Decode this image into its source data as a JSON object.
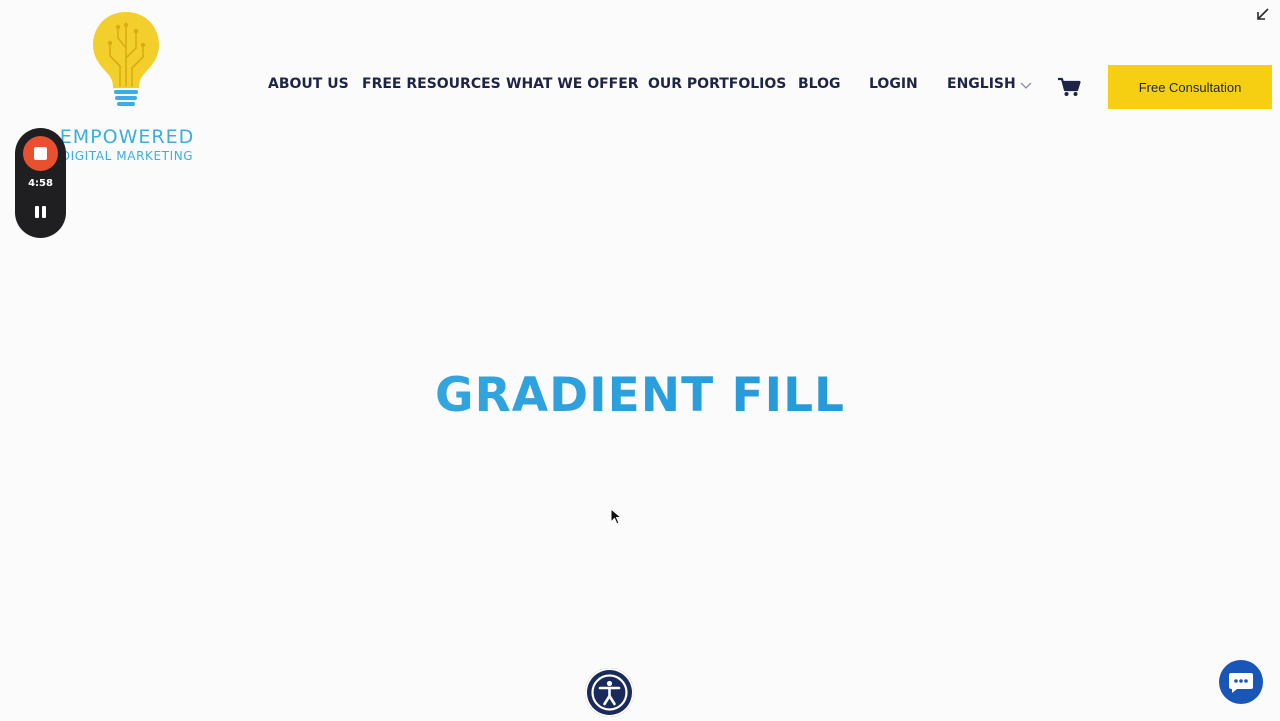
{
  "logo": {
    "line1": "EMPOWERED",
    "line2": "DIGITAL MARKETING",
    "icon": "lightbulb-circuit-icon",
    "bulb_color": "#f2cf2a",
    "text_color": "#3aaee3"
  },
  "nav": {
    "items": [
      "ABOUT US",
      "FREE RESOURCES",
      "WHAT WE OFFER",
      "OUR PORTFOLIOS",
      "BLOG",
      "LOGIN"
    ],
    "language": "ENGLISH",
    "cart_icon": "cart-icon",
    "cta_label": "Free Consultation",
    "cta_color": "#f7cf12",
    "text_color": "#1d2446"
  },
  "recorder": {
    "time": "4:58",
    "stop_icon": "stop-icon",
    "pause_icon": "pause-icon"
  },
  "hero": {
    "title": "GRADIENT FILL",
    "gradient_colors": [
      "#44b3e5",
      "#1b8fd3"
    ]
  },
  "widgets": {
    "accessibility_icon": "accessibility-icon",
    "chat_icon": "chat-icon",
    "corner_icon": "arrow-down-left-icon",
    "chat_color": "#1a55b8",
    "accessibility_color": "#1a2a5c"
  }
}
